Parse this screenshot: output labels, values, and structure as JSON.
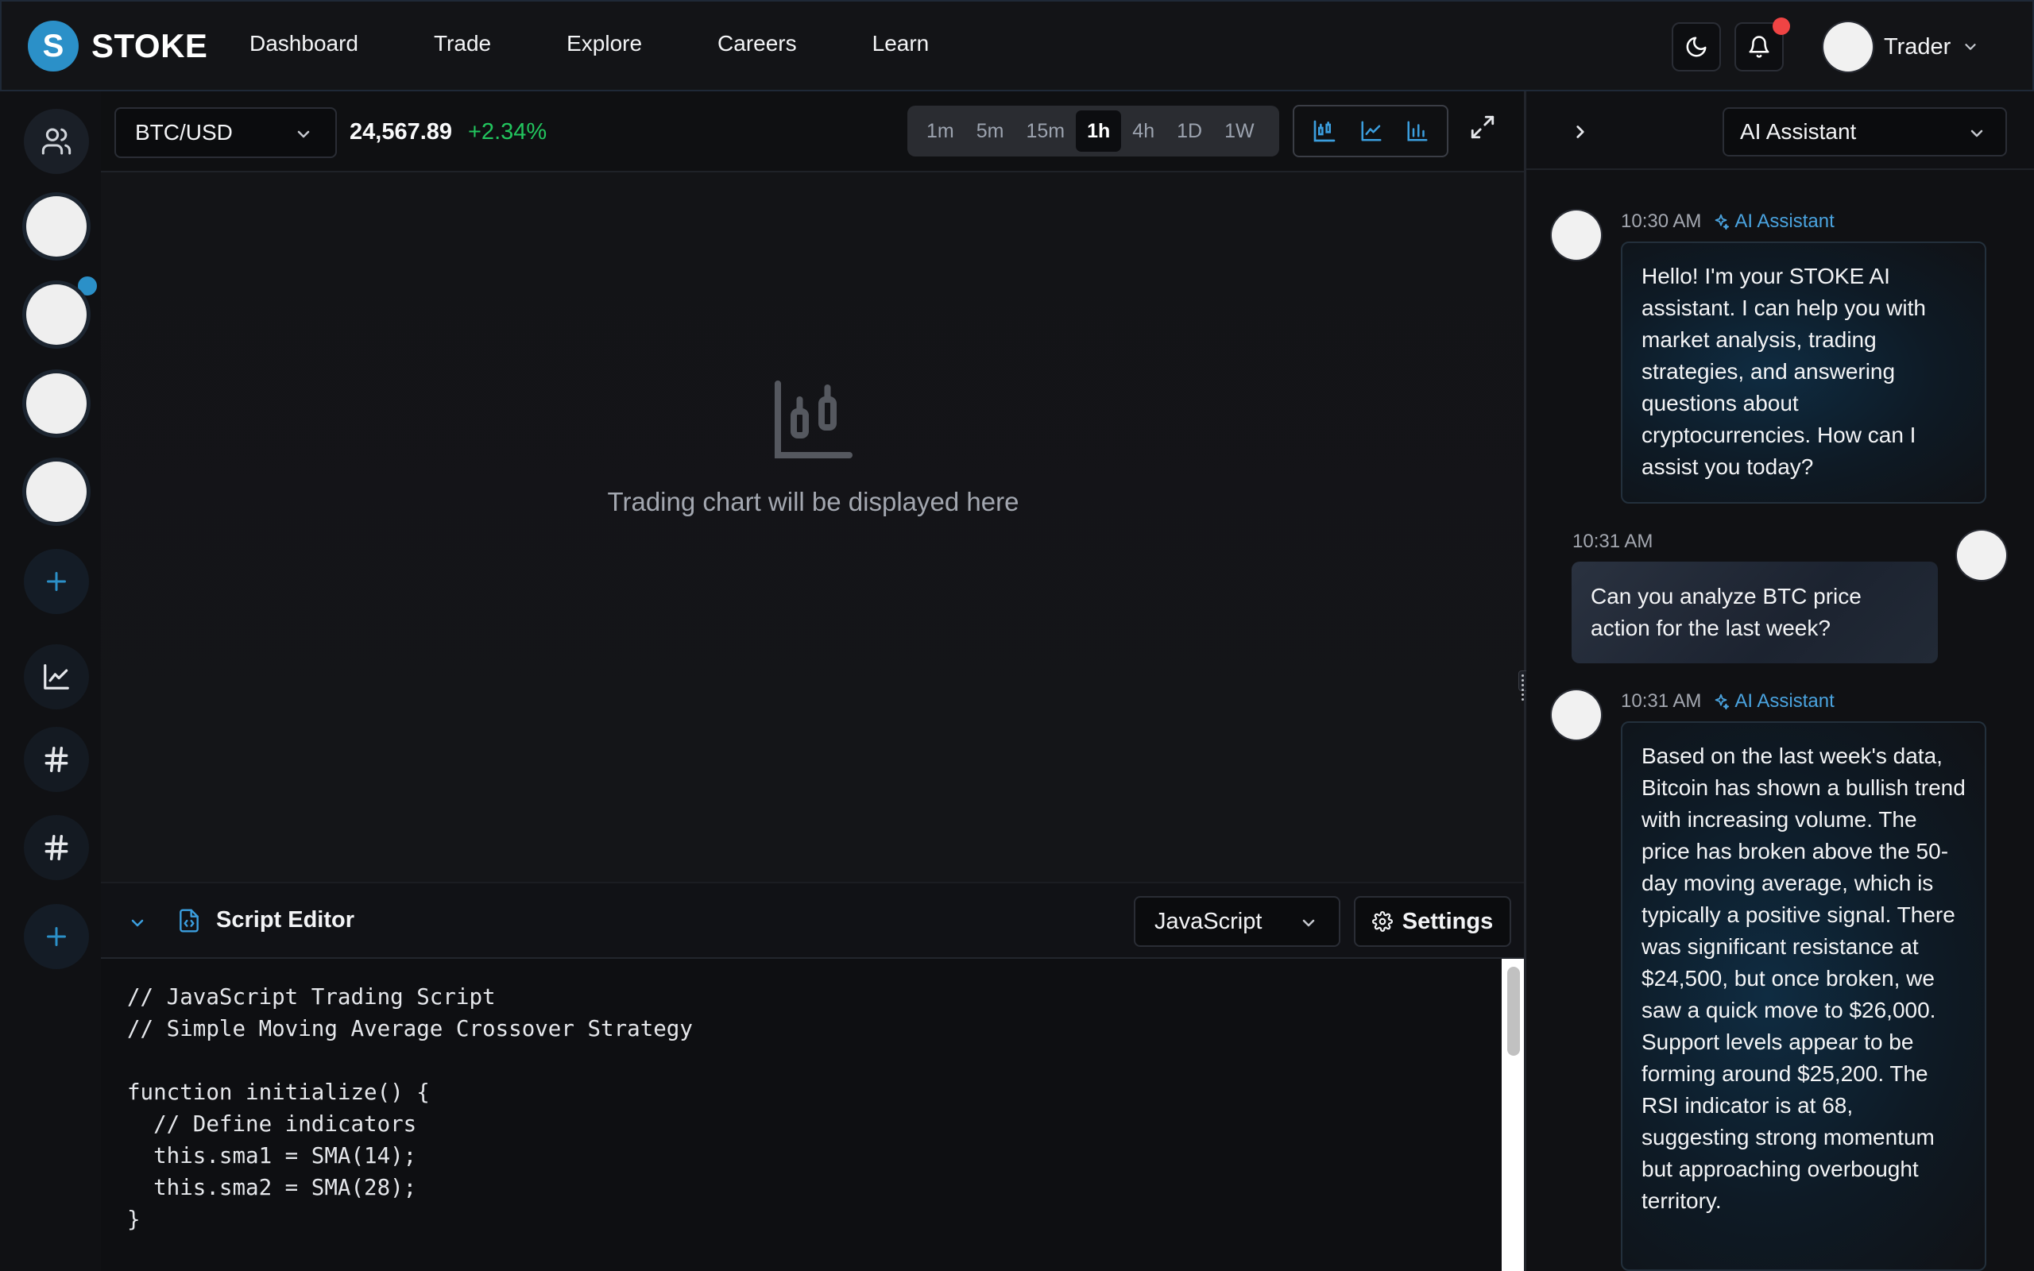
{
  "brand": {
    "logo_letter": "S",
    "name": "STOKE",
    "accent": "#2b90c8"
  },
  "nav": {
    "items": [
      "Dashboard",
      "Trade",
      "Explore",
      "Careers",
      "Learn"
    ]
  },
  "user": {
    "name": "Trader"
  },
  "toolbar": {
    "pair": "BTC/USD",
    "price": "24,567.89",
    "change": "+2.34%",
    "timeframes": [
      "1m",
      "5m",
      "15m",
      "1h",
      "4h",
      "1D",
      "1W"
    ],
    "active_timeframe": "1h"
  },
  "chart": {
    "placeholder": "Trading chart will be displayed here"
  },
  "editor": {
    "title": "Script Editor",
    "language": "JavaScript",
    "settings_label": "Settings",
    "code": "// JavaScript Trading Script\n// Simple Moving Average Crossover Strategy\n\nfunction initialize() {\n  // Define indicators\n  this.sma1 = SMA(14);\n  this.sma2 = SMA(28);\n}"
  },
  "chat": {
    "assistant_select": "AI Assistant",
    "messages": [
      {
        "time": "10:30 AM",
        "sender": "AI Assistant",
        "text": "Hello! I'm your STOKE AI assistant. I can help you with market analysis, trading strategies, and answering questions about cryptocurrencies. How can I assist you today?"
      },
      {
        "time": "10:31 AM",
        "text": "Can you analyze BTC price action for the last week?"
      },
      {
        "time": "10:31 AM",
        "sender": "AI Assistant",
        "text": "Based on the last week's data, Bitcoin has shown a bullish trend with increasing volume. The price has broken above the 50-day moving average, which is typically a positive signal. There was significant resistance at $24,500, but once broken, we saw a quick move to $26,000. Support levels appear to be forming around $25,200. The RSI indicator is at 68, suggesting strong momentum but approaching overbought territory."
      }
    ]
  },
  "colors": {
    "positive": "#22c55e",
    "notification": "#ef4444",
    "ai_label": "#4aa3df"
  }
}
